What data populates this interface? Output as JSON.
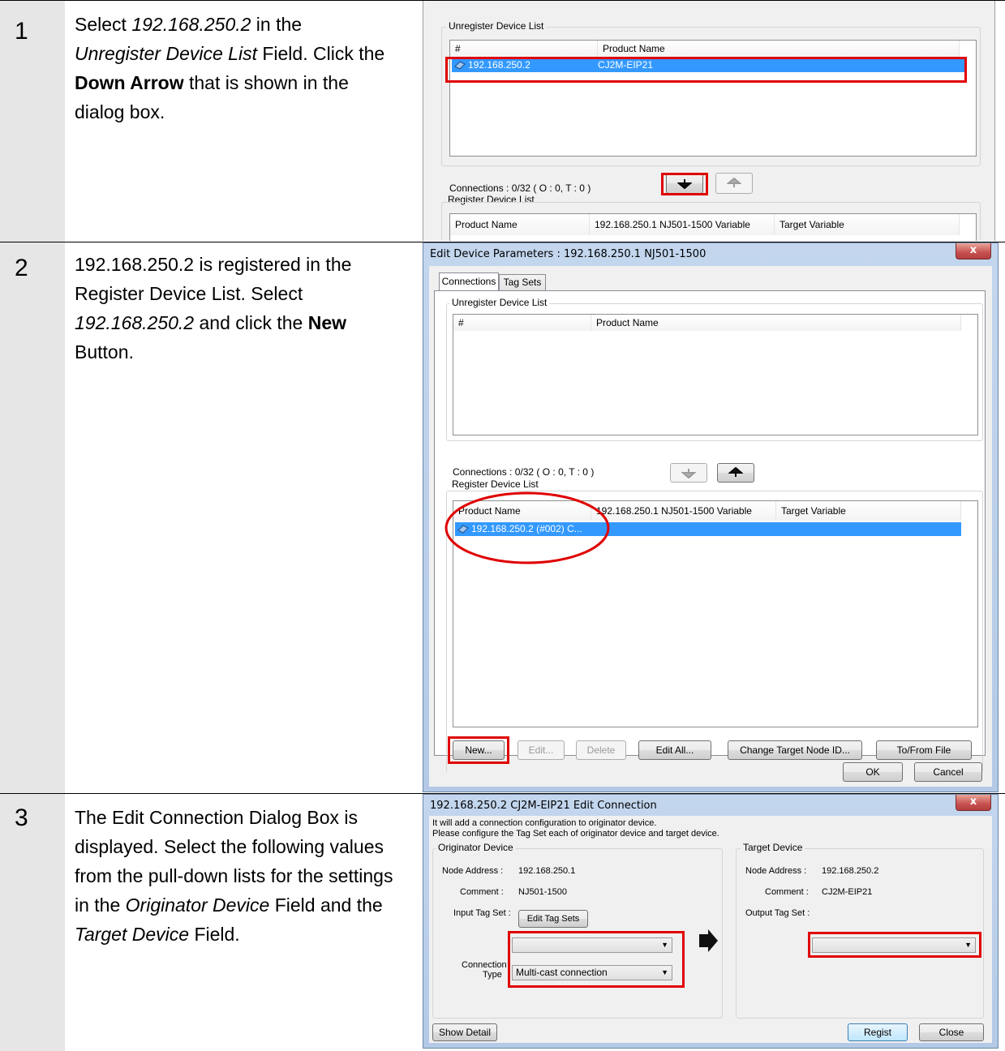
{
  "steps": [
    {
      "number": "1",
      "parts": [
        {
          "t": "Select "
        },
        {
          "t": "192.168.250.2",
          "s": "i"
        },
        {
          "t": " in the "
        },
        {
          "t": "Unregister Device List",
          "s": "i"
        },
        {
          "t": " Field. Click the "
        },
        {
          "t": "Down Arrow",
          "s": "b"
        },
        {
          "t": " that is shown in the dialog box."
        }
      ]
    },
    {
      "number": "2",
      "parts": [
        {
          "t": "192.168.250.2 is registered in the Register Device List. Select "
        },
        {
          "t": "192.168.250.2",
          "s": "i"
        },
        {
          "t": " and click the "
        },
        {
          "t": "New",
          "s": "b"
        },
        {
          "t": " Button."
        }
      ]
    },
    {
      "number": "3",
      "parts": [
        {
          "t": "The Edit Connection Dialog Box is displayed. Select the following values from the pull-down lists for the settings in the "
        },
        {
          "t": "Originator Device",
          "s": "i"
        },
        {
          "t": " Field and the "
        },
        {
          "t": "Target Device",
          "s": "i"
        },
        {
          "t": " Field."
        }
      ]
    }
  ],
  "shot1": {
    "unregister_label": "Unregister Device List",
    "col_hash": "#",
    "col_product": "Product Name",
    "row_ip": "192.168.250.2",
    "row_product": "CJ2M-EIP21",
    "connections": "Connections :  0/32 ( O : 0, T : 0 )",
    "register_label": "Register Device List",
    "reg_col_product": "Product Name",
    "reg_col_var": "192.168.250.1 NJ501-1500 Variable",
    "reg_col_target": "Target Variable"
  },
  "shot2": {
    "title": "Edit Device Parameters : 192.168.250.1 NJ501-1500",
    "close": "x",
    "tab_connections": "Connections",
    "tab_tagsets": "Tag Sets",
    "unregister_label": "Unregister Device List",
    "col_hash": "#",
    "col_product": "Product Name",
    "connections": "Connections :  0/32 ( O : 0, T : 0 )",
    "register_label": "Register Device List",
    "reg_col_product": "Product Name",
    "reg_col_var": "192.168.250.1 NJ501-1500 Variable",
    "reg_col_target": "Target Variable",
    "reg_row": "192.168.250.2 (#002) C...",
    "btn_new": "New...",
    "btn_edit": "Edit...",
    "btn_delete": "Delete",
    "btn_edit_all": "Edit All...",
    "btn_change": "Change Target Node ID...",
    "btn_tofrom": "To/From File",
    "btn_ok": "OK",
    "btn_cancel": "Cancel"
  },
  "shot3": {
    "title": "192.168.250.2 CJ2M-EIP21 Edit Connection",
    "close": "x",
    "info1": "It will add a connection configuration to originator device.",
    "info2": "Please configure the Tag Set each of originator device and target device.",
    "orig_label": "Originator Device",
    "orig_node_label": "Node Address :",
    "orig_node": "192.168.250.1",
    "orig_comment_label": "Comment :",
    "orig_comment": "NJ501-1500",
    "input_tag_label": "Input Tag Set :",
    "edit_tag_sets": "Edit Tag Sets",
    "conn_type_label1": "Connection",
    "conn_type_label2": "Type",
    "conn_type": "Multi-cast connection",
    "target_label": "Target Device",
    "tgt_node_label": "Node Address :",
    "tgt_node": "192.168.250.2",
    "tgt_comment_label": "Comment :",
    "tgt_comment": "CJ2M-EIP21",
    "output_tag_label": "Output Tag Set :",
    "show_detail": "Show Detail",
    "regist": "Regist",
    "close_btn": "Close"
  }
}
